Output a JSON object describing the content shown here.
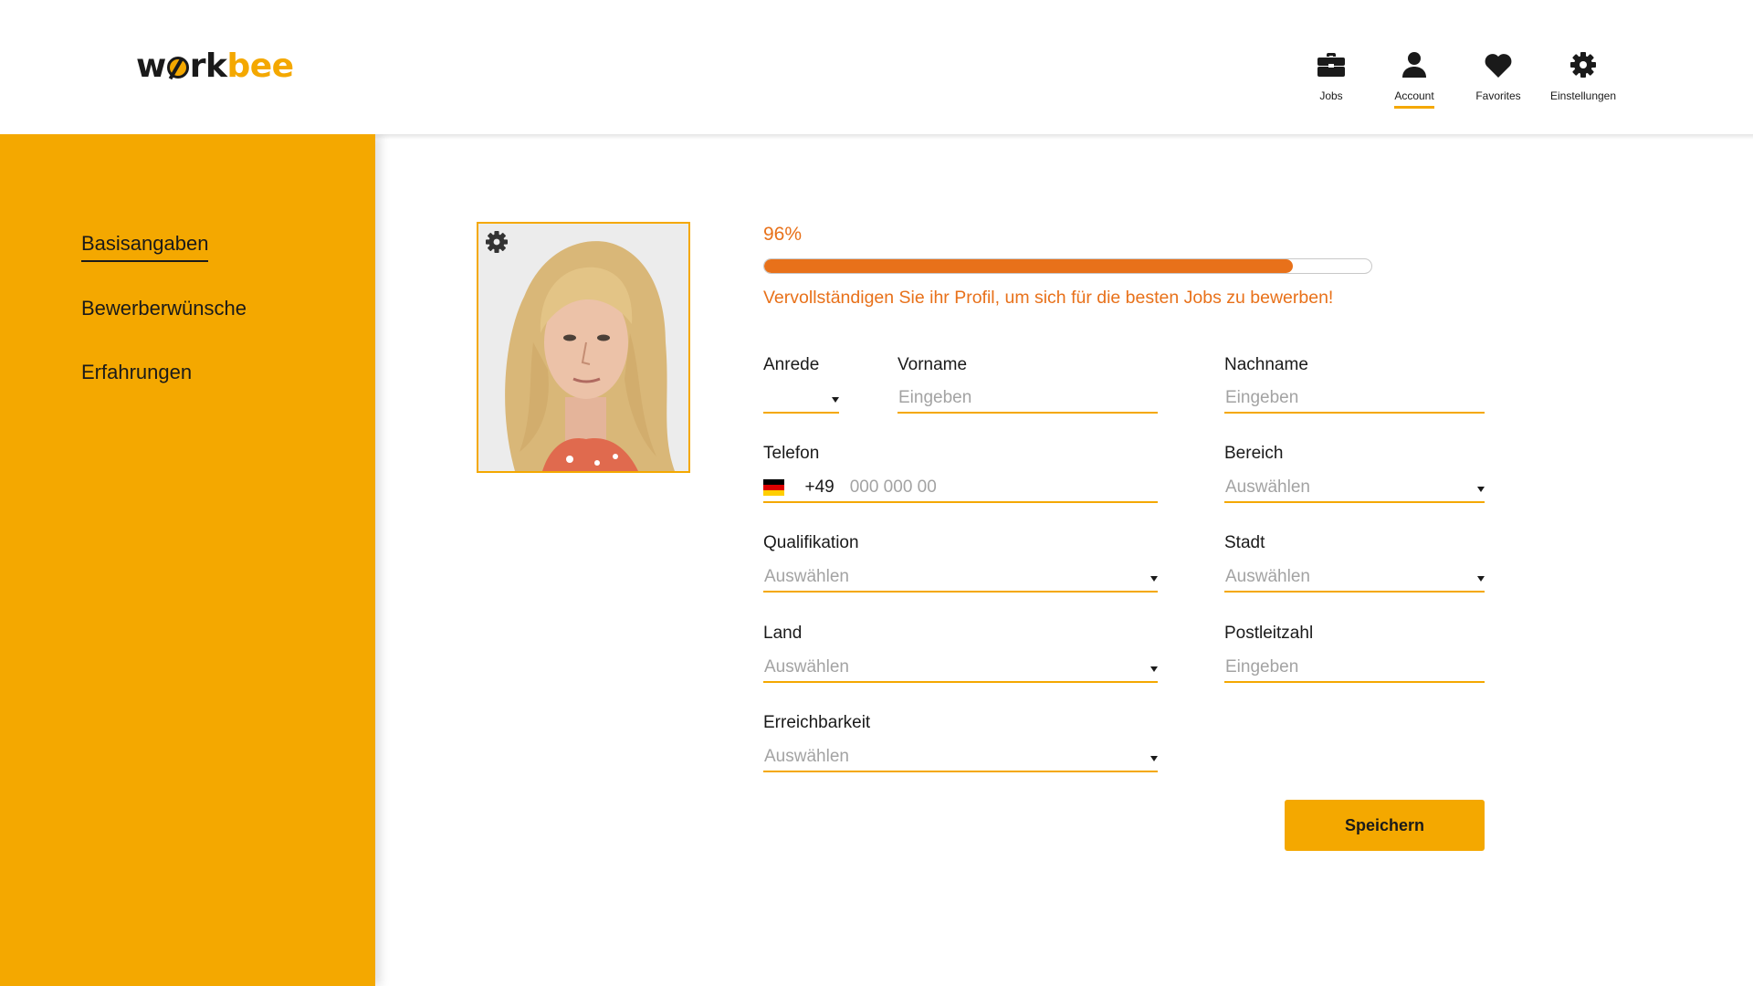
{
  "app": {
    "logo_dark": "w",
    "logo_dark_2": "rk",
    "logo_accent": "bee",
    "brand_color": "#f4a800",
    "accent_orange": "#e8711a"
  },
  "nav": {
    "items": [
      {
        "label": "Jobs",
        "icon": "briefcase-icon"
      },
      {
        "label": "Account",
        "icon": "user-icon",
        "active": true
      },
      {
        "label": "Favorites",
        "icon": "heart-icon"
      },
      {
        "label": "Einstellungen",
        "icon": "gear-icon"
      }
    ]
  },
  "sidebar": {
    "items": [
      {
        "label": "Basisangaben",
        "active": true
      },
      {
        "label": "Bewerberwünsche"
      },
      {
        "label": "Erfahrungen"
      }
    ]
  },
  "profile": {
    "photo_alt": "profile-photo",
    "progress_label": "96%",
    "progress_value": 0.87,
    "hint": "Vervollständigen Sie ihr Profil, um sich für die besten Jobs zu bewerben!"
  },
  "form": {
    "anrede": {
      "label": "Anrede",
      "value": ""
    },
    "vorname": {
      "label": "Vorname",
      "placeholder": "Eingeben"
    },
    "nachname": {
      "label": "Nachname",
      "placeholder": "Eingeben"
    },
    "telefon": {
      "label": "Telefon",
      "prefix": "+49",
      "placeholder": "000 000 00"
    },
    "bereich": {
      "label": "Bereich",
      "value": "Auswählen"
    },
    "qualifikation": {
      "label": "Qualifikation",
      "value": "Auswählen"
    },
    "stadt": {
      "label": "Stadt",
      "value": "Auswählen"
    },
    "land": {
      "label": "Land",
      "value": "Auswählen"
    },
    "postleitzahl": {
      "label": "Postleitzahl",
      "placeholder": "Eingeben"
    },
    "erreichbarkeit": {
      "label": "Erreichbarkeit",
      "value": "Auswählen"
    }
  },
  "actions": {
    "save_label": "Speichern"
  }
}
